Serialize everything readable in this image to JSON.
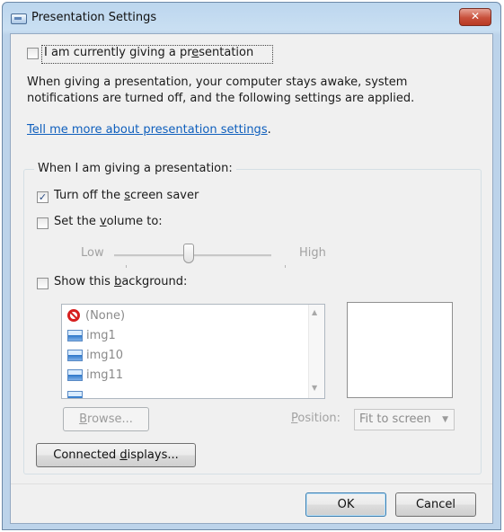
{
  "window": {
    "title": "Presentation Settings",
    "close_label": "✕"
  },
  "top": {
    "checkbox_label_parts": [
      "I am currently giving a pr",
      "e",
      "sentation"
    ],
    "description": "When giving a presentation, your computer stays awake, system notifications are turned off, and the following settings are applied.",
    "link_text": "Tell me more about presentation settings",
    "link_suffix": "."
  },
  "group": {
    "title": "When I am giving a presentation:",
    "screen_saver": {
      "parts": [
        "Turn off the ",
        "s",
        "creen saver"
      ],
      "checked": true
    },
    "volume": {
      "parts": [
        "Set the ",
        "v",
        "olume to:"
      ],
      "checked": false,
      "low_label": "Low",
      "high_label": "High",
      "level_fraction": 0.5
    },
    "background": {
      "parts": [
        "Show this ",
        "b",
        "ackground:"
      ],
      "checked": false
    },
    "list_items": [
      "(None)",
      "img1",
      "img10",
      "img11"
    ],
    "browse_parts": [
      "B",
      "rowse..."
    ],
    "position_parts": [
      "P",
      "osition:"
    ],
    "position_value": "Fit to screen"
  },
  "connected_displays_parts": [
    "Connected ",
    "d",
    "isplays..."
  ],
  "buttons": {
    "ok": "OK",
    "cancel": "Cancel"
  }
}
